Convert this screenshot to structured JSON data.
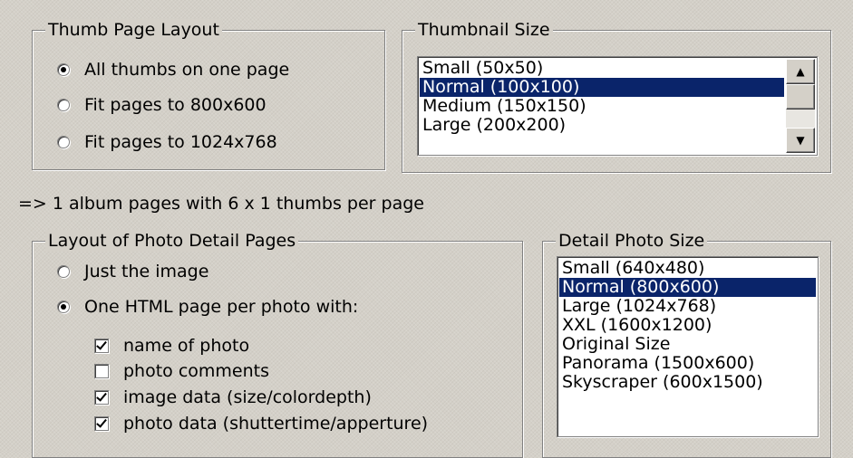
{
  "thumb_layout": {
    "title": "Thumb Page Layout",
    "options": [
      {
        "label": "All thumbs on one page",
        "selected": true
      },
      {
        "label": "Fit pages to 800x600",
        "selected": false
      },
      {
        "label": "Fit pages to 1024x768",
        "selected": false
      }
    ]
  },
  "thumbnail_size": {
    "title": "Thumbnail Size",
    "items": [
      "Small (50x50)",
      "Normal (100x100)",
      "Medium (150x150)",
      "Large (200x200)"
    ],
    "selected": "Normal (100x100)",
    "scroll_up_icon": "triangle-up",
    "scroll_down_icon": "triangle-down"
  },
  "summary": "=> 1 album pages with 6 x 1 thumbs per page",
  "detail_layout": {
    "title": "Layout of Photo Detail Pages",
    "options": [
      {
        "label": "Just the image",
        "selected": false
      },
      {
        "label": "One HTML page per photo with:",
        "selected": true
      }
    ],
    "checks": [
      {
        "label": "name of photo",
        "checked": true
      },
      {
        "label": "photo comments",
        "checked": false
      },
      {
        "label": "image data (size/colordepth)",
        "checked": true
      },
      {
        "label": "photo data (shuttertime/apperture)",
        "checked": true
      }
    ]
  },
  "detail_size": {
    "title": "Detail Photo Size",
    "items": [
      "Small (640x480)",
      "Normal (800x600)",
      "Large (1024x768)",
      "XXL (1600x1200)",
      "Original Size",
      "Panorama (1500x600)",
      "Skyscraper (600x1500)"
    ],
    "selected": "Normal (800x600)"
  },
  "colors": {
    "selection": "#0a246a",
    "face": "#d4d0c8"
  }
}
